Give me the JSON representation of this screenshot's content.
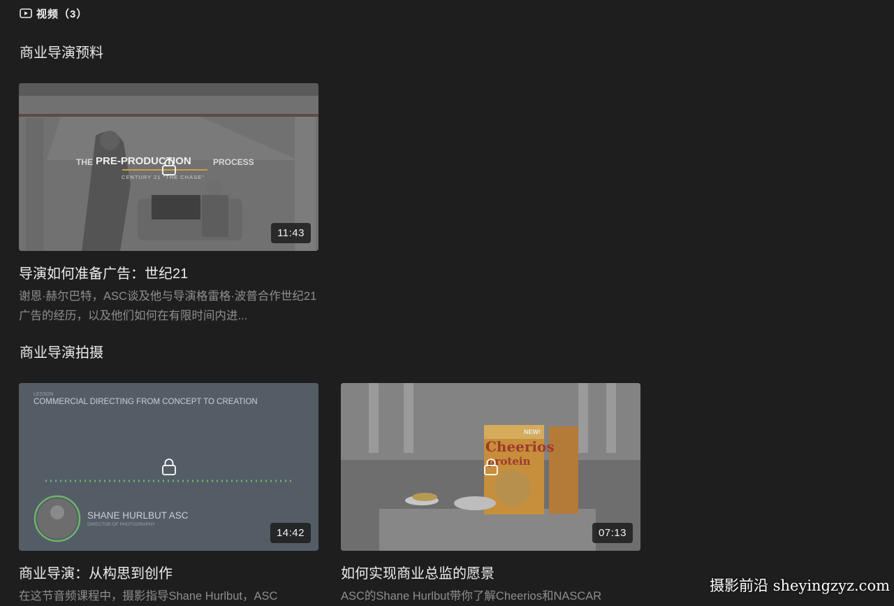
{
  "header": {
    "title": "视频（3）",
    "icon": "video-icon"
  },
  "sections": [
    {
      "title": "商业导演预料",
      "cards": [
        {
          "title": "导演如何准备广告：世纪21",
          "description": "谢恩·赫尔巴特，ASC谈及他与导演格雷格·波普合作世纪21广告的经历，以及他们如何在有限时间内进...",
          "duration": "11:43",
          "thumbnail_text": {
            "main_a": "THE",
            "main_b": "PRE-PRODUCTION",
            "main_c": "PROCESS",
            "sub": "CENTURY 21 \"THE CHASE\""
          }
        }
      ]
    },
    {
      "title": "商业导演拍摄",
      "cards": [
        {
          "title": "商业导演：从构思到创作",
          "description": "在这节音频课程中，摄影指导Shane Hurlbut，ASC",
          "duration": "14:42",
          "thumbnail_text": {
            "lesson": "LESSON",
            "heading": "COMMERCIAL DIRECTING FROM CONCEPT TO CREATION",
            "name": "SHANE HURLBUT ASC",
            "role": "DIRECTOR OF PHOTOGRAPHY"
          }
        },
        {
          "title": "如何实现商业总监的愿景",
          "description": "ASC的Shane Hurlbut带你了解Cheerios和NASCAR",
          "duration": "07:13",
          "thumbnail_text": {
            "badge": "NEW!",
            "brand": "Cheerios",
            "variant": "protein"
          }
        }
      ]
    }
  ],
  "watermark": "摄影前沿 sheyingzyz.com",
  "colors": {
    "background": "#1e1e1f",
    "title": "#ededed",
    "description": "#8e8e8e",
    "duration_bg": "#1c1c1c"
  }
}
